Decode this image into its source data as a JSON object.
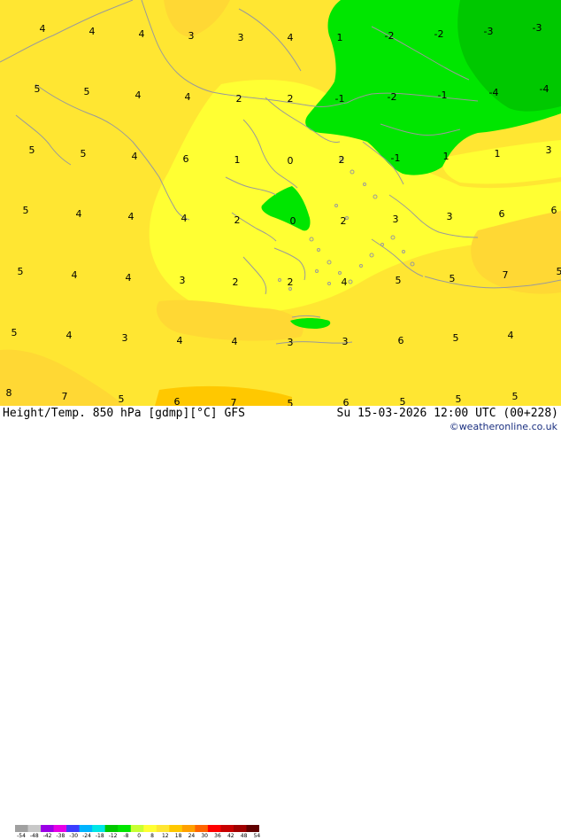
{
  "map": {
    "colors": {
      "sea_level_yellow": "#ffe632",
      "pale_yellow": "#ffff33",
      "warm_yellow": "#ffd834",
      "light_green": "#00e600",
      "mid_green": "#00c800",
      "coast": "#9a9a9a"
    },
    "values": [
      {
        "v": "4"
      },
      {
        "v": "4"
      },
      {
        "v": "4"
      },
      {
        "v": "3"
      },
      {
        "v": "3"
      },
      {
        "v": "4"
      },
      {
        "v": "1"
      },
      {
        "v": "-2"
      },
      {
        "v": "-2"
      },
      {
        "v": "-3"
      },
      {
        "v": "-3"
      },
      {
        "v": "5"
      },
      {
        "v": "5"
      },
      {
        "v": "4"
      },
      {
        "v": "4"
      },
      {
        "v": "2"
      },
      {
        "v": "2"
      },
      {
        "v": "-1"
      },
      {
        "v": "-2"
      },
      {
        "v": "-1"
      },
      {
        "v": "-4"
      },
      {
        "v": "-4"
      },
      {
        "v": "5"
      },
      {
        "v": "5"
      },
      {
        "v": "4"
      },
      {
        "v": "6"
      },
      {
        "v": "1"
      },
      {
        "v": "0"
      },
      {
        "v": "2"
      },
      {
        "v": "-1"
      },
      {
        "v": "1"
      },
      {
        "v": "1"
      },
      {
        "v": "3"
      },
      {
        "v": "5"
      },
      {
        "v": "4"
      },
      {
        "v": "4"
      },
      {
        "v": "4"
      },
      {
        "v": "2"
      },
      {
        "v": "0"
      },
      {
        "v": "2"
      },
      {
        "v": "3"
      },
      {
        "v": "3"
      },
      {
        "v": "6"
      },
      {
        "v": "6"
      },
      {
        "v": "5"
      },
      {
        "v": "4"
      },
      {
        "v": "4"
      },
      {
        "v": "3"
      },
      {
        "v": "2"
      },
      {
        "v": "2"
      },
      {
        "v": "4"
      },
      {
        "v": "5"
      },
      {
        "v": "5"
      },
      {
        "v": "7"
      },
      {
        "v": "5"
      },
      {
        "v": "5"
      },
      {
        "v": "4"
      },
      {
        "v": "3"
      },
      {
        "v": "4"
      },
      {
        "v": "4"
      },
      {
        "v": "3"
      },
      {
        "v": "3"
      },
      {
        "v": "6"
      },
      {
        "v": "5"
      },
      {
        "v": "4"
      },
      {
        "v": "8"
      },
      {
        "v": "7"
      },
      {
        "v": "5"
      },
      {
        "v": "6"
      },
      {
        "v": "7"
      },
      {
        "v": "5"
      },
      {
        "v": "6"
      },
      {
        "v": "5"
      },
      {
        "v": "5"
      },
      {
        "v": "5"
      }
    ]
  },
  "footer": {
    "title": "Height/Temp. 850 hPa [gdmp][°C] GFS",
    "datetime": "Su 15-03-2026 12:00 UTC (00+228)",
    "credit": "©weatheronline.co.uk"
  },
  "colorbar": {
    "ticks": [
      "-54",
      "-48",
      "-42",
      "-38",
      "-30",
      "-24",
      "-18",
      "-12",
      "-8",
      "0",
      "8",
      "12",
      "18",
      "24",
      "30",
      "36",
      "42",
      "48",
      "54"
    ],
    "colors": [
      "#a0a0a0",
      "#c8c8c8",
      "#9b00e6",
      "#e600e6",
      "#3c3cff",
      "#00b4ff",
      "#00e6e6",
      "#00c800",
      "#00e600",
      "#c8ff32",
      "#ffff33",
      "#ffe632",
      "#ffc800",
      "#ffa000",
      "#ff6400",
      "#ff0000",
      "#c80000",
      "#a00000",
      "#600000"
    ]
  }
}
